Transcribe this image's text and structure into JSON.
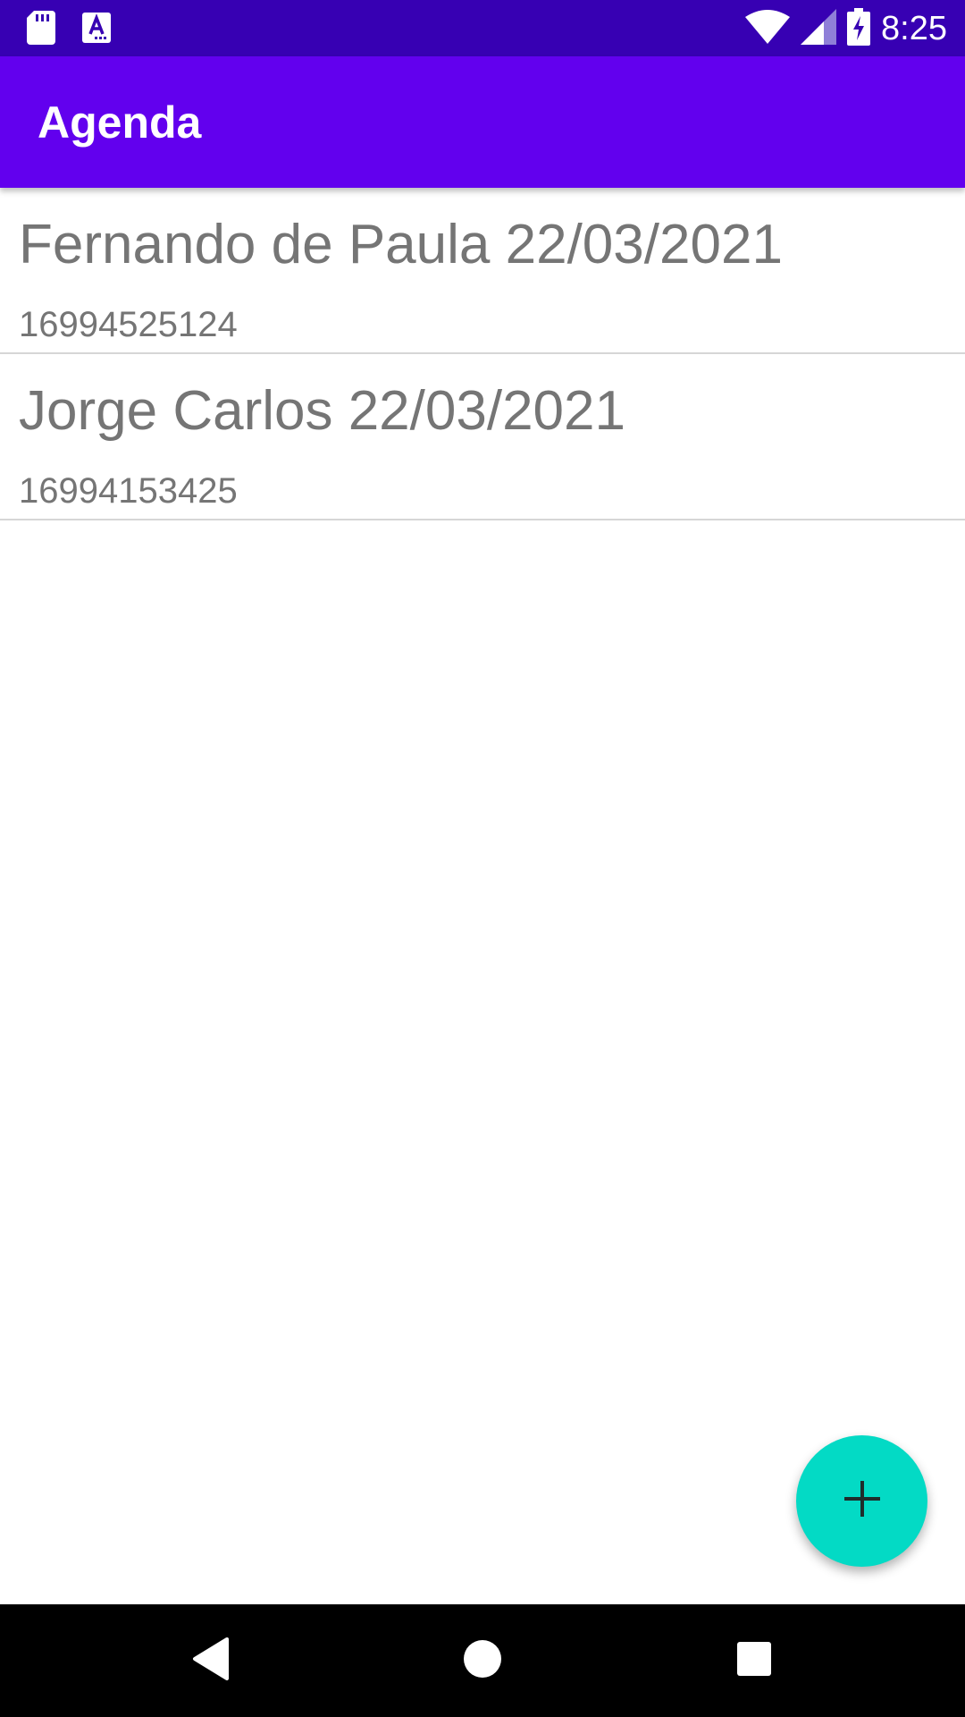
{
  "status_bar": {
    "time": "8:25",
    "icons_left": [
      "sd-card-icon",
      "text-notification-icon"
    ],
    "icons_right": [
      "wifi-icon",
      "cell-signal-icon",
      "battery-charging-icon"
    ]
  },
  "app_bar": {
    "title": "Agenda"
  },
  "contacts": [
    {
      "name_line": "Fernando de Paula 22/03/2021",
      "phone": "16994525124"
    },
    {
      "name_line": "Jorge Carlos 22/03/2021",
      "phone": "16994153425"
    }
  ],
  "fab": {
    "icon": "plus-icon"
  },
  "nav_bar": {
    "buttons": [
      "back-icon",
      "home-icon",
      "recents-icon"
    ]
  },
  "colors": {
    "status_bar": "#3700B3",
    "app_bar": "#6200EE",
    "fab": "#03DAC5",
    "list_text": "#757575",
    "divider": "#d6d6d6",
    "nav_bar": "#000000"
  }
}
